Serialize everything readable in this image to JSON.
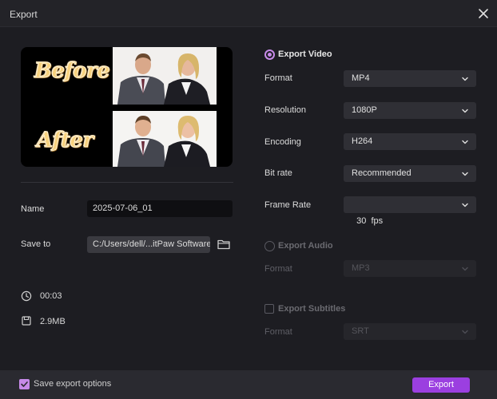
{
  "window": {
    "title": "Export"
  },
  "preview": {
    "before_label": "Before",
    "after_label": "After"
  },
  "file": {
    "name_label": "Name",
    "name_value": "2025-07-06_01",
    "save_to_label": "Save to",
    "save_to_value": "C:/Users/dell/...itPaw Software",
    "duration": "00:03",
    "size": "2.9MB"
  },
  "video": {
    "title": "Export Video",
    "selected": true,
    "options": [
      {
        "label": "Format",
        "value": "MP4"
      },
      {
        "label": "Resolution",
        "value": "1080P"
      },
      {
        "label": "Encoding",
        "value": "H264"
      },
      {
        "label": "Bit rate",
        "value": "Recommended"
      },
      {
        "label": "Frame Rate",
        "value": "30  fps"
      }
    ]
  },
  "audio": {
    "title": "Export Audio",
    "selected": false,
    "format_label": "Format",
    "format_value": "MP3"
  },
  "subtitles": {
    "title": "Export Subtitles",
    "checked": false,
    "format_label": "Format",
    "format_value": "SRT"
  },
  "footer": {
    "save_options_label": "Save export options",
    "save_options_checked": true,
    "export_label": "Export"
  },
  "colors": {
    "accent": "#9b3fe0",
    "radio": "#c78ae8",
    "background": "#1d1d22"
  },
  "icons": [
    "close-icon",
    "folder-icon",
    "clock-icon",
    "file-size-icon",
    "chevron-down-icon"
  ]
}
